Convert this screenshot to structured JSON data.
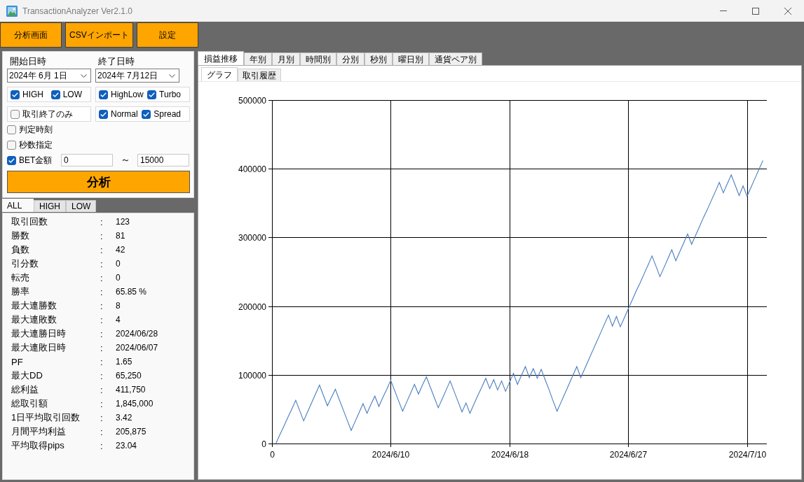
{
  "window": {
    "title": "TransactionAnalyzer Ver2.1.0"
  },
  "toolbar": [
    {
      "label": "分析画面"
    },
    {
      "label": "CSVインポート"
    },
    {
      "label": "設定"
    }
  ],
  "date_range": [
    {
      "label": "開始日時",
      "value": "2024年 6月 1日"
    },
    {
      "label": "終了日時",
      "value": "2024年 7月12日"
    }
  ],
  "option_groups": [
    {
      "options": [
        {
          "label": "HIGH",
          "checked": true
        },
        {
          "label": "LOW",
          "checked": true
        }
      ]
    },
    {
      "options": [
        {
          "label": "HighLow",
          "checked": true
        },
        {
          "label": "Turbo",
          "checked": true
        }
      ]
    },
    {
      "options": [
        {
          "label": "取引終了のみ",
          "checked": false
        }
      ]
    },
    {
      "options": [
        {
          "label": "Normal",
          "checked": true
        },
        {
          "label": "Spread",
          "checked": true
        }
      ]
    }
  ],
  "options": [
    {
      "label": "判定時刻",
      "checked": false
    },
    {
      "label": "秒数指定",
      "checked": false
    }
  ],
  "bet_range": {
    "label": "BET金額",
    "checked": true,
    "min": "0",
    "separator": "～",
    "max": "15000"
  },
  "analyze_button": {
    "label": "分析"
  },
  "summary_tabs": [
    {
      "label": "ALL",
      "selected": true
    },
    {
      "label": "HIGH",
      "selected": false
    },
    {
      "label": "LOW",
      "selected": false
    }
  ],
  "summary": [
    {
      "label": "取引回数",
      "separator": ":",
      "value": "123"
    },
    {
      "label": "勝数",
      "separator": ":",
      "value": "81"
    },
    {
      "label": "負数",
      "separator": ":",
      "value": "42"
    },
    {
      "label": "引分数",
      "separator": ":",
      "value": "0"
    },
    {
      "label": "転売",
      "separator": ":",
      "value": "0"
    },
    {
      "label": "勝率",
      "separator": ":",
      "value": "65.85 %"
    },
    {
      "label": "最大連勝数",
      "separator": ":",
      "value": "8"
    },
    {
      "label": "最大連敗数",
      "separator": ":",
      "value": "4"
    },
    {
      "label": "最大連勝日時",
      "separator": ":",
      "value": "2024/06/28"
    },
    {
      "label": "最大連敗日時",
      "separator": ":",
      "value": "2024/06/07"
    },
    {
      "label": "PF",
      "separator": ":",
      "value": "1.65"
    },
    {
      "label": "最大DD",
      "separator": ":",
      "value": "65,250"
    },
    {
      "label": "総利益",
      "separator": ":",
      "value": "411,750"
    },
    {
      "label": "総取引額",
      "separator": ":",
      "value": "1,845,000"
    },
    {
      "label": "1日平均取引回数",
      "separator": ":",
      "value": "3.42"
    },
    {
      "label": "月間平均利益",
      "separator": ":",
      "value": "205,875"
    },
    {
      "label": "平均取得pips",
      "separator": ":",
      "value": "23.04"
    }
  ],
  "view_tabs": [
    {
      "label": "損益推移",
      "selected": true
    },
    {
      "label": "年別",
      "selected": false
    },
    {
      "label": "月別",
      "selected": false
    },
    {
      "label": "時間別",
      "selected": false
    },
    {
      "label": "分別",
      "selected": false
    },
    {
      "label": "秒別",
      "selected": false
    },
    {
      "label": "曜日別",
      "selected": false
    },
    {
      "label": "通貨ペア別",
      "selected": false
    }
  ],
  "sub_tabs": [
    {
      "label": "グラフ",
      "selected": true
    },
    {
      "label": "取引履歴",
      "selected": false
    }
  ],
  "graph_panel": {
    "chart_data": {
      "type": "line",
      "color": "#4a7ebf",
      "grid": true,
      "ylim": [
        0,
        500000
      ],
      "yticks": [
        0,
        100000,
        200000,
        300000,
        400000,
        500000
      ],
      "categories": [
        "0",
        null,
        null,
        null,
        null,
        null,
        null,
        null,
        null,
        null,
        null,
        null,
        null,
        null,
        null,
        null,
        null,
        null,
        null,
        null,
        null,
        null,
        null,
        null,
        null,
        null,
        null,
        null,
        null,
        null,
        "2024/6/10",
        null,
        null,
        null,
        null,
        null,
        null,
        null,
        null,
        null,
        null,
        null,
        null,
        null,
        null,
        null,
        null,
        null,
        null,
        null,
        null,
        null,
        null,
        null,
        null,
        null,
        null,
        null,
        null,
        null,
        "2024/6/18",
        null,
        null,
        null,
        null,
        null,
        null,
        null,
        null,
        null,
        null,
        null,
        null,
        null,
        null,
        null,
        null,
        null,
        null,
        null,
        null,
        null,
        null,
        null,
        null,
        null,
        null,
        null,
        null,
        null,
        "2024/6/27",
        null,
        null,
        null,
        null,
        null,
        null,
        null,
        null,
        null,
        null,
        null,
        null,
        null,
        null,
        null,
        null,
        null,
        null,
        null,
        null,
        null,
        null,
        null,
        null,
        null,
        null,
        null,
        null,
        null,
        "2024/7/10",
        null,
        null,
        null,
        null
      ],
      "values": [
        null,
        0,
        13000,
        25000,
        38000,
        50000,
        63000,
        48000,
        33000,
        46000,
        59000,
        72000,
        85000,
        70000,
        55000,
        67000,
        79000,
        64000,
        49000,
        34000,
        19000,
        32000,
        45000,
        58000,
        44000,
        57000,
        69000,
        54000,
        67000,
        79000,
        92000,
        77000,
        62000,
        47000,
        60000,
        73000,
        86000,
        72000,
        85000,
        97000,
        82000,
        67000,
        52000,
        65000,
        78000,
        91000,
        76000,
        61000,
        46000,
        59000,
        44000,
        57000,
        70000,
        82000,
        95000,
        80000,
        93000,
        78000,
        91000,
        76000,
        89000,
        102000,
        86000,
        99000,
        112000,
        96000,
        109000,
        95000,
        108000,
        93000,
        78000,
        62000,
        47000,
        60000,
        73000,
        86000,
        99000,
        112000,
        96000,
        109000,
        122000,
        135000,
        148000,
        161000,
        174000,
        187000,
        171000,
        185000,
        170000,
        183000,
        196000,
        209000,
        222000,
        234000,
        247000,
        260000,
        273000,
        258000,
        243000,
        256000,
        269000,
        282000,
        266000,
        279000,
        292000,
        305000,
        290000,
        303000,
        316000,
        329000,
        341000,
        354000,
        367000,
        380000,
        365000,
        378000,
        391000,
        376000,
        361000,
        375000,
        360000,
        373000,
        386000,
        399000,
        412000
      ]
    }
  }
}
